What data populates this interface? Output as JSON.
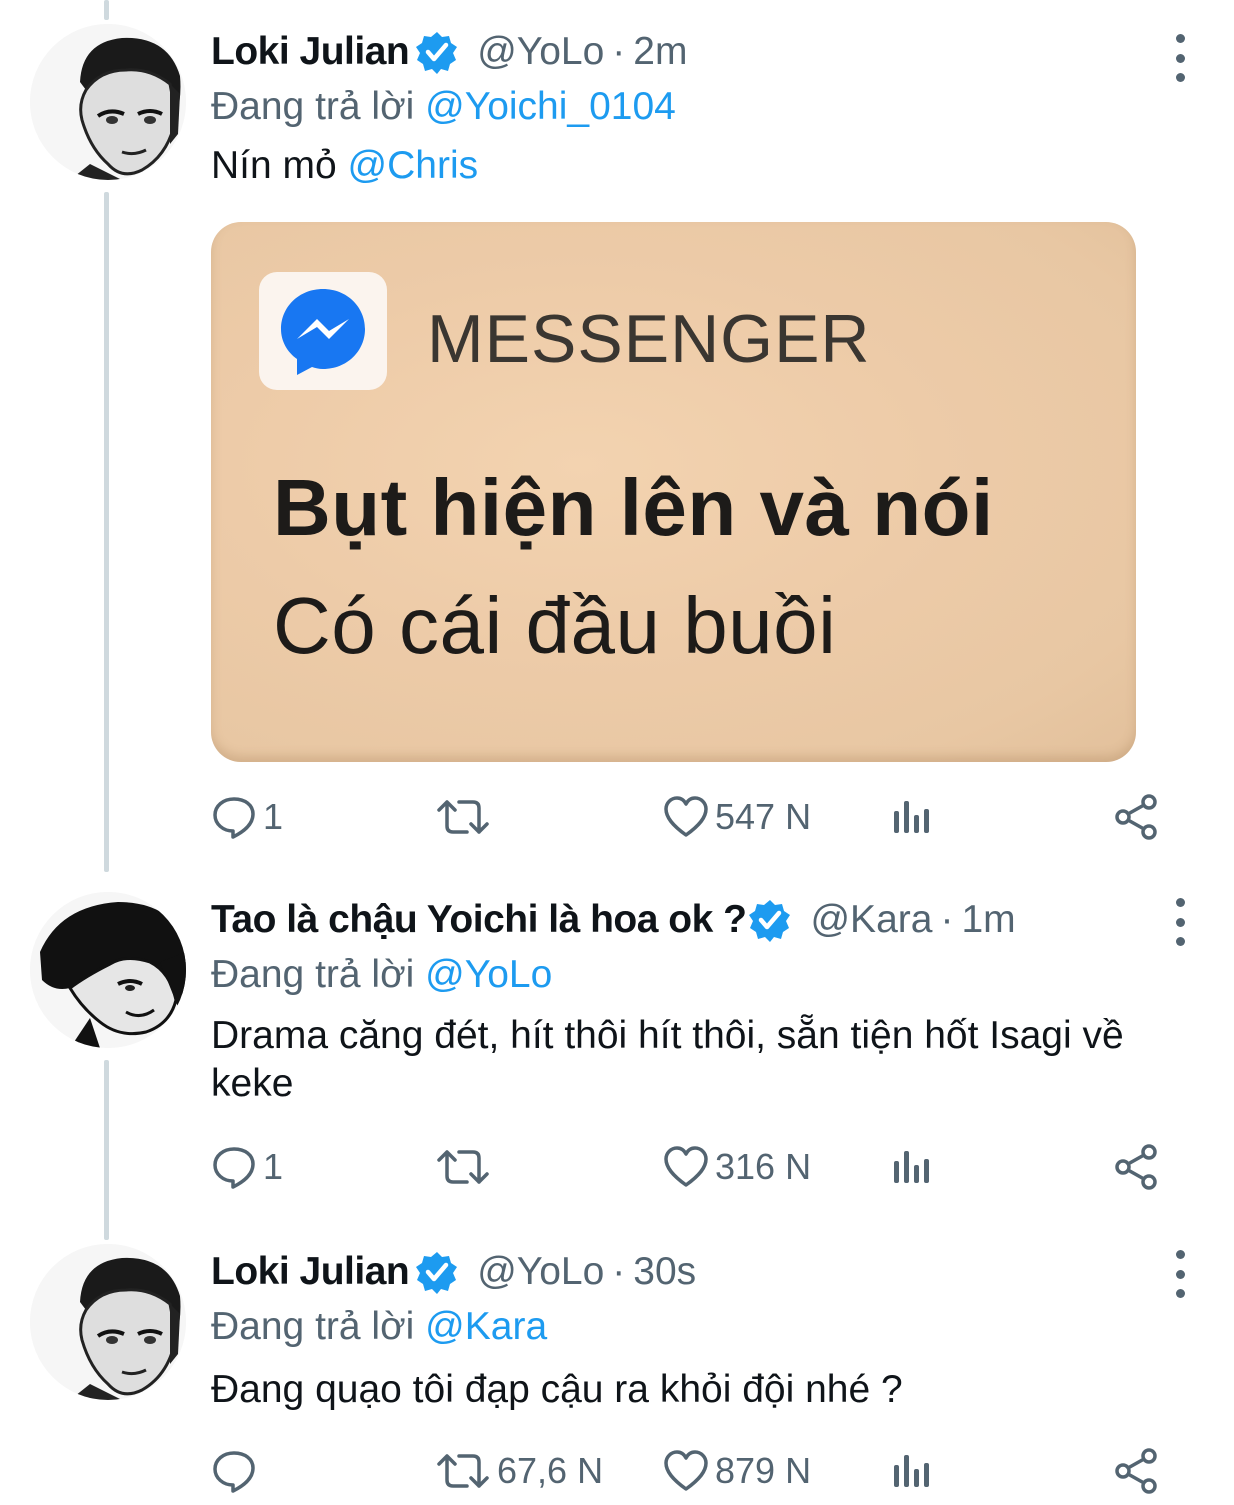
{
  "tweets": [
    {
      "name": "Loki Julian",
      "handle": "@YoLo",
      "dot": "·",
      "time": "2m",
      "reply_prefix": "Đang trả lời",
      "reply_mention": "@Yoichi_0104",
      "text": "Nín mỏ",
      "text_mention": "@Chris",
      "media": {
        "app_icon": "messenger-icon",
        "app_name": "MESSENGER",
        "line1": "Bụt hiện lên và nói",
        "line2": "Có cái đầu buồi"
      },
      "actions": {
        "reply_count": "1",
        "retweet_count": "",
        "like_count": "547 N"
      }
    },
    {
      "name": "Tao là chậu Yoichi là hoa ok ?",
      "handle": "@Kara",
      "dot": "·",
      "time": "1m",
      "reply_prefix": "Đang trả lời",
      "reply_mention": "@YoLo",
      "text": "Drama căng đét, hít thôi hít thôi, sẵn tiện hốt Isagi về keke",
      "actions": {
        "reply_count": "1",
        "retweet_count": "",
        "like_count": "316 N"
      }
    },
    {
      "name": "Loki Julian",
      "handle": "@YoLo",
      "dot": "·",
      "time": "30s",
      "reply_prefix": "Đang trả lời",
      "reply_mention": "@Kara",
      "text": "Đang quạo tôi đạp cậu ra khỏi đội nhé ?",
      "actions": {
        "reply_count": "",
        "retweet_count": "67,6 N",
        "like_count": "879 N"
      }
    }
  ],
  "icons": {
    "reply": "reply-icon",
    "retweet": "retweet-icon",
    "like": "heart-icon",
    "views": "analytics-icon",
    "share": "share-icon",
    "verified": "verified-badge-icon",
    "more": "more-options-icon"
  },
  "colors": {
    "link": "#1d9bf0",
    "secondary_text": "#536471",
    "thread_line": "#cfd9de",
    "verified": "#1d9bf0",
    "messenger_blue": "#1877f2"
  }
}
